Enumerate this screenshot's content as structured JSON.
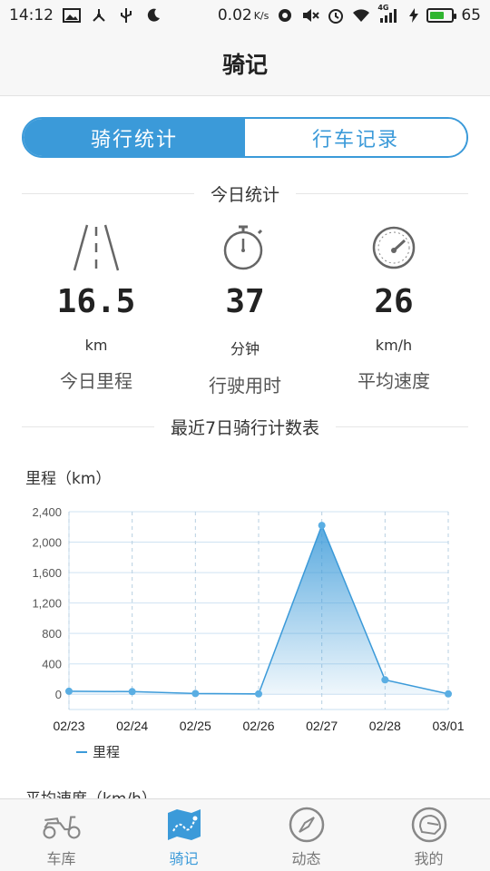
{
  "status_bar": {
    "time": "14:12",
    "net_speed": "0.02",
    "net_speed_unit": "K/s",
    "network_type": "4G",
    "battery": "65",
    "battery_level": 0.65
  },
  "header": {
    "title": "骑记"
  },
  "tabs": [
    {
      "label": "骑行统计",
      "active": true
    },
    {
      "label": "行车记录",
      "active": false
    }
  ],
  "today": {
    "section_title": "今日统计",
    "stats": [
      {
        "icon": "road-icon",
        "value": "16.5",
        "unit": "km",
        "label": "今日里程"
      },
      {
        "icon": "stopwatch-icon",
        "value": "37",
        "unit": "分钟",
        "label": "行驶用时"
      },
      {
        "icon": "speedometer-icon",
        "value": "26",
        "unit": "km/h",
        "label": "平均速度"
      }
    ]
  },
  "weekly": {
    "section_title": "最近7日骑行计数表"
  },
  "chart_data": {
    "type": "area",
    "title": "",
    "ylabel": "里程（km）",
    "xlabel": "",
    "categories": [
      "02/23",
      "02/24",
      "02/25",
      "02/26",
      "02/27",
      "02/28",
      "03/01"
    ],
    "series": [
      {
        "name": "里程",
        "values": [
          40,
          35,
          10,
          5,
          2220,
          190,
          5
        ]
      }
    ],
    "ylim": [
      -200,
      2400
    ],
    "yticks": [
      0,
      400,
      800,
      1200,
      1600,
      2000,
      2400
    ],
    "ytick_labels": [
      "0",
      "400",
      "800",
      "1,200",
      "1,600",
      "2,000",
      "2,400"
    ],
    "grid": true,
    "legend_position": "bottom-left",
    "color": "#3b9ad9"
  },
  "next_section": {
    "title": "平均速度（km/h）"
  },
  "bottom_nav": [
    {
      "icon": "scooter-icon",
      "label": "车库",
      "active": false
    },
    {
      "icon": "map-icon",
      "label": "骑记",
      "active": true
    },
    {
      "icon": "compass-icon",
      "label": "动态",
      "active": false
    },
    {
      "icon": "helmet-icon",
      "label": "我的",
      "active": false
    }
  ],
  "colors": {
    "accent": "#3b9ad9",
    "battery": "#2fb52f"
  }
}
